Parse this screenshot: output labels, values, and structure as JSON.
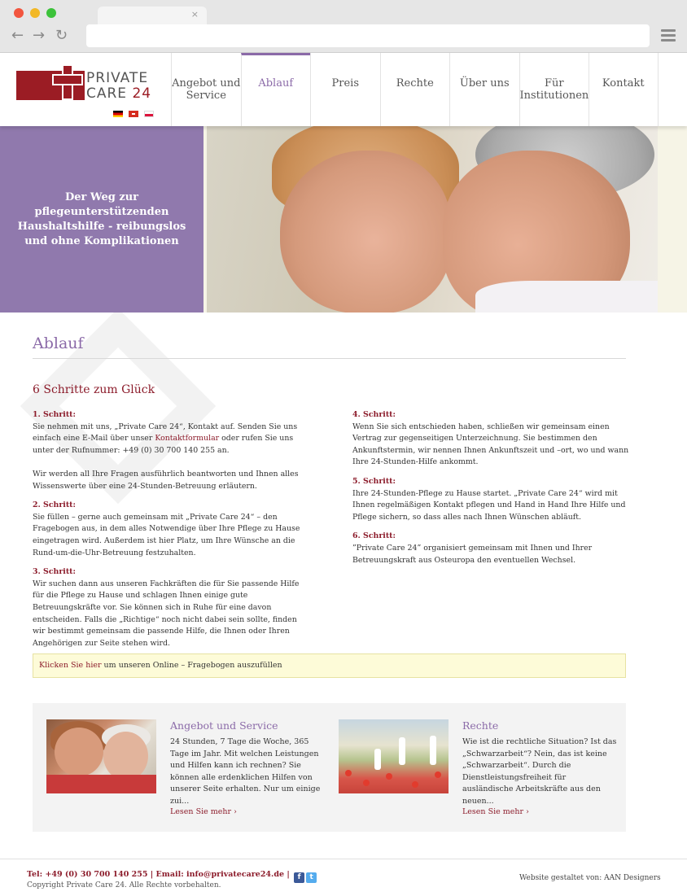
{
  "browser": {
    "tab_close": "×",
    "nav_back": "←",
    "nav_forward": "→",
    "nav_reload": "↻"
  },
  "logo": {
    "line1": "PRIVATE",
    "line2_word": "CARE",
    "line2_num": "24"
  },
  "languages": [
    "de",
    "ch",
    "pl"
  ],
  "menu": [
    {
      "label": "Angebot und Service",
      "active": false
    },
    {
      "label": "Ablauf",
      "active": true
    },
    {
      "label": "Preis",
      "active": false
    },
    {
      "label": "Rechte",
      "active": false
    },
    {
      "label": "Über uns",
      "active": false
    },
    {
      "label": "Für Institutionen",
      "active": false
    },
    {
      "label": "Kontakt",
      "active": false
    }
  ],
  "hero": {
    "title": "Der Weg zur pflegeunterstützenden Haushaltshilfe - reibungslos und ohne Komplikationen"
  },
  "page": {
    "title": "Ablauf",
    "subtitle": "6 Schritte zum Glück",
    "steps_left": [
      {
        "heading": "1. Schritt:",
        "p1_a": "Sie nehmen mit uns, „Private Care 24“, Kontakt auf. Senden Sie uns einfach eine E-Mail über unser ",
        "p1_link": "Kontaktformular",
        "p1_b": " oder rufen Sie uns unter der Rufnummer: +49 (0) 30 700 140 255 an.",
        "p2": "Wir werden all Ihre Fragen ausführlich beantworten und Ihnen alles Wissenswerte über eine 24-Stunden-Betreuung erläutern."
      },
      {
        "heading": "2. Schritt:",
        "text": "Sie füllen – gerne auch gemeinsam mit „Private Care 24“ – den Fragebogen aus, in dem alles Notwendige über Ihre Pflege zu Hause eingetragen wird. Außerdem ist hier Platz, um Ihre Wünsche an die Rund-um-die-Uhr-Betreuung festzuhalten."
      },
      {
        "heading": "3. Schritt:",
        "text": "Wir suchen dann aus unseren Fachkräften die für Sie passende Hilfe für die Pflege zu Hause und schlagen Ihnen einige gute Betreuungskräfte vor. Sie können sich in Ruhe für eine davon entscheiden. Falls die „Richtige“ noch nicht dabei sein sollte, finden wir bestimmt gemeinsam die passende Hilfe, die Ihnen oder Ihren Angehörigen zur Seite stehen wird."
      }
    ],
    "steps_right": [
      {
        "heading": "4. Schritt:",
        "text": "Wenn Sie sich entschieden haben, schließen wir gemeinsam einen Vertrag zur gegenseitigen Unterzeichnung. Sie bestimmen den Ankunftstermin, wir nennen Ihnen Ankunftszeit und –ort, wo und wann Ihre 24-Stunden-Hilfe ankommt."
      },
      {
        "heading": "5. Schritt:",
        "text": "Ihre 24-Stunden-Pflege zu Hause startet. „Private Care 24“ wird mit Ihnen regelmäßigen Kontakt pflegen und Hand in Hand Ihre Hilfe und Pflege sichern, so dass alles nach Ihnen Wünschen abläuft."
      },
      {
        "heading": "6. Schritt:",
        "text": "”Private Care 24” organisiert gemeinsam mit Ihnen und Ihrer Betreuungskraft aus Osteuropa den eventuellen Wechsel."
      }
    ],
    "notice_link": "Klicken Sie hier",
    "notice_text": " um unseren Online – Fragebogen auszufüllen"
  },
  "teasers": [
    {
      "title": "Angebot und Service",
      "text": "24 Stunden, 7 Tage die Woche, 365 Tage im Jahr. Mit welchen Leistungen und Hilfen kann ich rechnen? Sie können alle erdenklichen Hilfen von unserer Seite erhalten. Nur um einige zui...",
      "more": "Lesen Sie mehr ›"
    },
    {
      "title": "Rechte",
      "text": "Wie ist die rechtliche Situation? Ist das „Schwarzarbeit“? Nein, das ist keine „Schwarzarbeit“. Durch die Dienstleistungsfreiheit für ausländische Arbeitskräfte aus den neuen...",
      "more": "Lesen Sie mehr ›"
    }
  ],
  "footer": {
    "contact": "Tel: +49 (0) 30 700 140 255 | Email: info@privatecare24.de |",
    "facebook_glyph": "f",
    "twitter_glyph": "t",
    "copyright": "Copyright Private Care 24. Alle Rechte vorbehalten.",
    "credit": "Website gestaltet von: AAN Designers"
  },
  "colors": {
    "brand_red": "#9b1c24",
    "accent_purple": "#8b6aa8",
    "hero_panel": "#9079ad",
    "notice_bg": "#fdfbd8"
  }
}
